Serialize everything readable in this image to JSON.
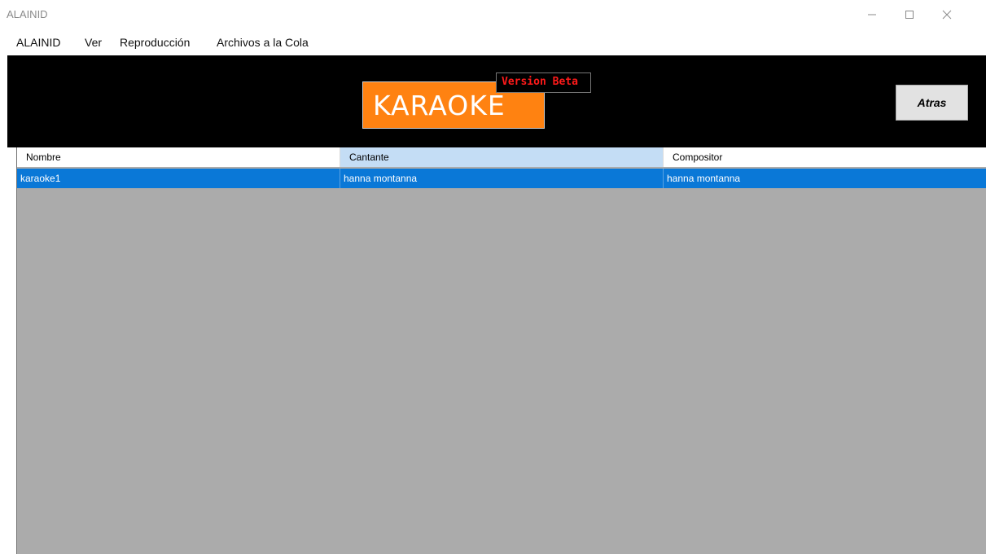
{
  "window": {
    "title": "ALAINID",
    "controls": {
      "minimize": "minimize-icon",
      "maximize": "maximize-icon",
      "close": "close-icon"
    }
  },
  "menu": {
    "items": [
      {
        "label": "ALAINID"
      },
      {
        "label": "Ver"
      },
      {
        "label": "Reproducción"
      },
      {
        "label": "Archivos a la Cola"
      }
    ]
  },
  "header": {
    "logo_text": "KARAOKE",
    "beta_label": "Version Beta",
    "back_button_label": "Atras",
    "colors": {
      "background": "#000000",
      "logo": "#ff8211",
      "beta_text": "#ff1a1a"
    }
  },
  "table": {
    "columns": [
      {
        "label": "Nombre"
      },
      {
        "label": "Cantante"
      },
      {
        "label": "Compositor"
      }
    ],
    "rows": [
      {
        "cells": [
          "karaoke1",
          "hanna montanna",
          "hanna montanna"
        ],
        "selected": true
      }
    ],
    "colors": {
      "selected_row": "#0a78d7",
      "active_header": "#c4ddf5",
      "empty_area": "#ababab"
    }
  }
}
